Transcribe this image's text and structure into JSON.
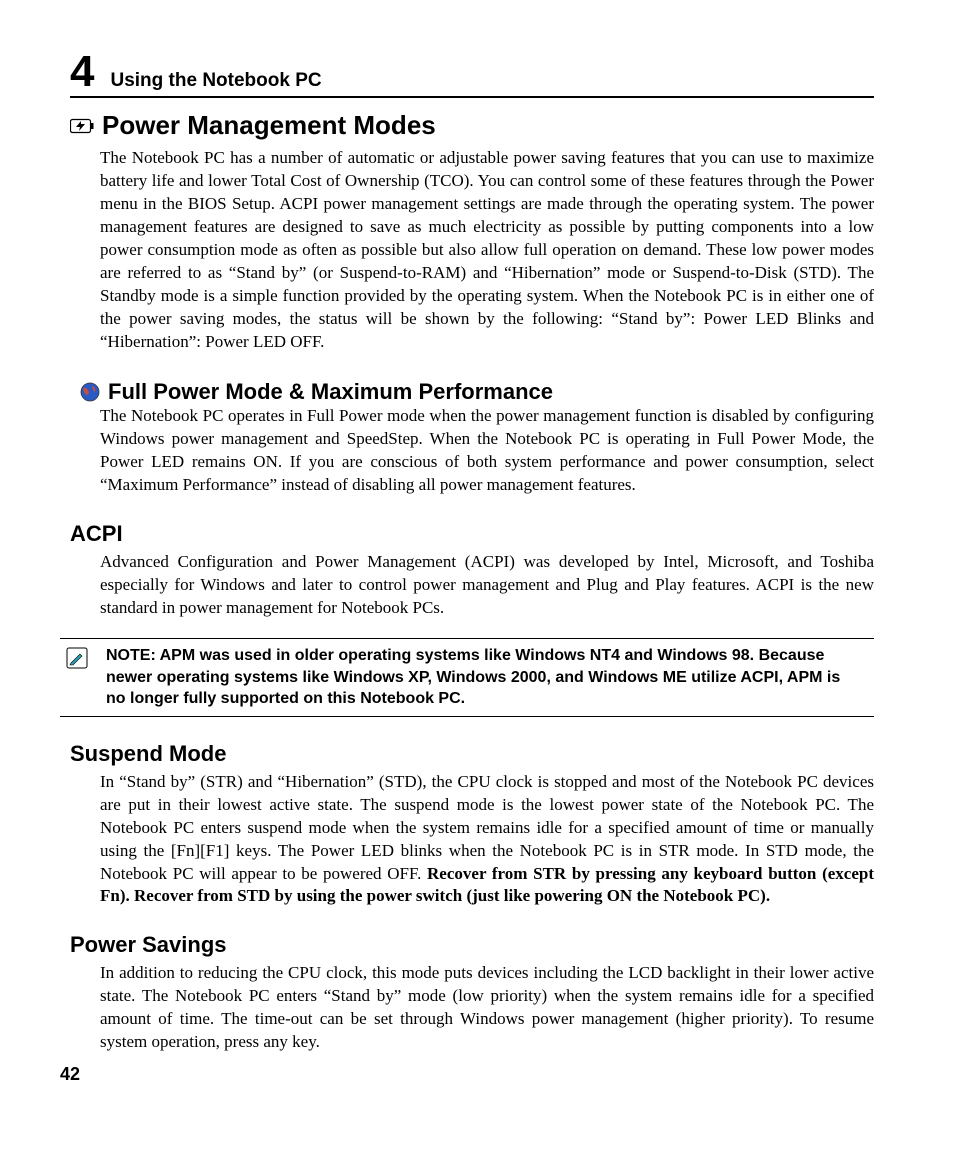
{
  "chapter": {
    "number": "4",
    "title": "Using the Notebook PC"
  },
  "section": {
    "title": "Power Management Modes",
    "body": "The Notebook PC has a number of automatic or adjustable power saving features that you can use to maximize battery life and lower Total Cost of Ownership (TCO). You can control some of these features through the Power menu in the BIOS Setup. ACPI power management settings are made through the operating system. The power management features are designed to save as much electricity as possible by putting components into a low power consumption mode as often as possible but also allow full operation on demand. These low power modes are referred to as “Stand by” (or Suspend-to-RAM) and “Hibernation” mode or Suspend-to-Disk (STD). The Standby mode is a simple function provided by the operating system. When the Notebook PC is in either one of the power saving modes, the status will be shown by the following: “Stand by”: Power LED Blinks and “Hibernation”: Power LED OFF."
  },
  "fullpower": {
    "title": "Full Power Mode & Maximum Performance",
    "body": "The Notebook PC operates in Full Power mode when the power management function is disabled by configuring Windows power management and SpeedStep. When the Notebook PC is operating in Full Power Mode, the Power LED remains ON. If you are conscious of both system performance and power consumption, select “Maximum Performance” instead of disabling all power management features."
  },
  "acpi": {
    "title": "ACPI",
    "body": "Advanced Configuration and Power Management (ACPI) was developed by Intel, Microsoft, and Toshiba especially for Windows and later to control power management and Plug and Play features. ACPI is the new standard in power management for Notebook PCs."
  },
  "note": {
    "text": "NOTE: APM was used in older operating systems like Windows NT4 and Windows 98. Because newer operating systems like Windows XP, Windows 2000, and Windows ME utilize ACPI, APM is no longer fully supported on this Notebook PC."
  },
  "suspend": {
    "title": "Suspend Mode",
    "body_plain": "In “Stand by” (STR) and “Hibernation” (STD), the CPU clock is stopped and most of the Notebook PC devices are put in their lowest active state. The suspend mode is the lowest power state of the Notebook PC. The Notebook PC enters suspend mode when the system remains idle for a specified amount of time or manually using the [Fn][F1] keys. The Power LED blinks when the Notebook PC is in STR mode. In STD mode, the Notebook PC will appear to be powered OFF. ",
    "body_bold": "Recover from STR by pressing any keyboard button (except Fn). Recover from STD by using the power switch (just like powering ON the Notebook PC)."
  },
  "powersavings": {
    "title": "Power Savings",
    "body": "In addition to reducing the CPU clock, this mode puts devices including the LCD backlight in their lower active state. The Notebook PC enters “Stand by” mode (low priority) when the system remains idle for a specified amount of time. The time-out can be set through Windows power management (higher priority). To resume system operation, press any key."
  },
  "page_number": "42"
}
